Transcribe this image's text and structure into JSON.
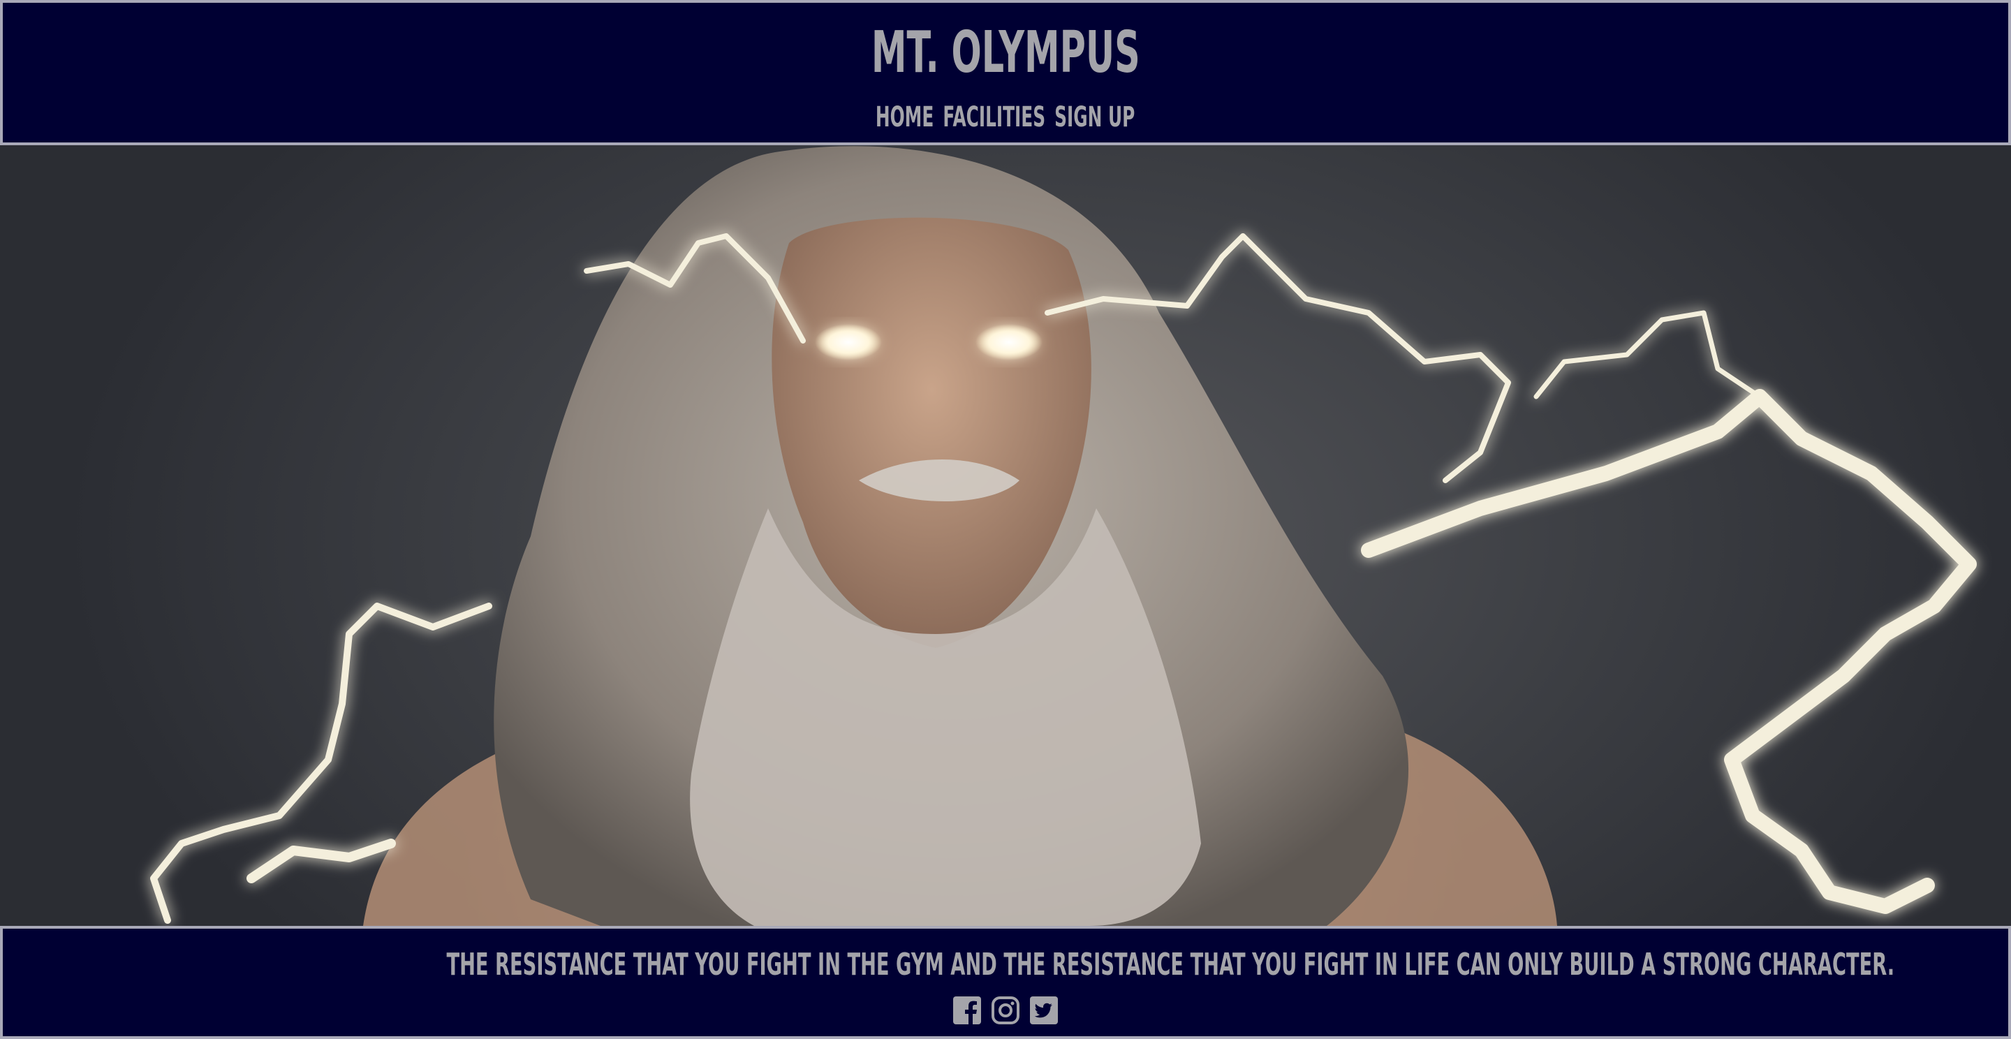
{
  "header": {
    "title": "MT. OLYMPUS",
    "nav": [
      {
        "label": "HOME"
      },
      {
        "label": "FACILITIES"
      },
      {
        "label": "SIGN UP"
      }
    ]
  },
  "hero": {
    "image_subject": "zeus-with-lightning"
  },
  "footer": {
    "quote": "THE RESISTANCE THAT YOU FIGHT IN THE GYM AND THE RESISTANCE THAT YOU FIGHT IN LIFE CAN ONLY BUILD A STRONG CHARACTER.",
    "socials": [
      {
        "icon": "facebook-icon"
      },
      {
        "icon": "instagram-icon"
      },
      {
        "icon": "twitter-icon"
      }
    ]
  },
  "colors": {
    "navy": "#000033",
    "text_gray": "#a4a4aa",
    "border": "#a9a9b8",
    "lightning": "#f4efdc"
  }
}
